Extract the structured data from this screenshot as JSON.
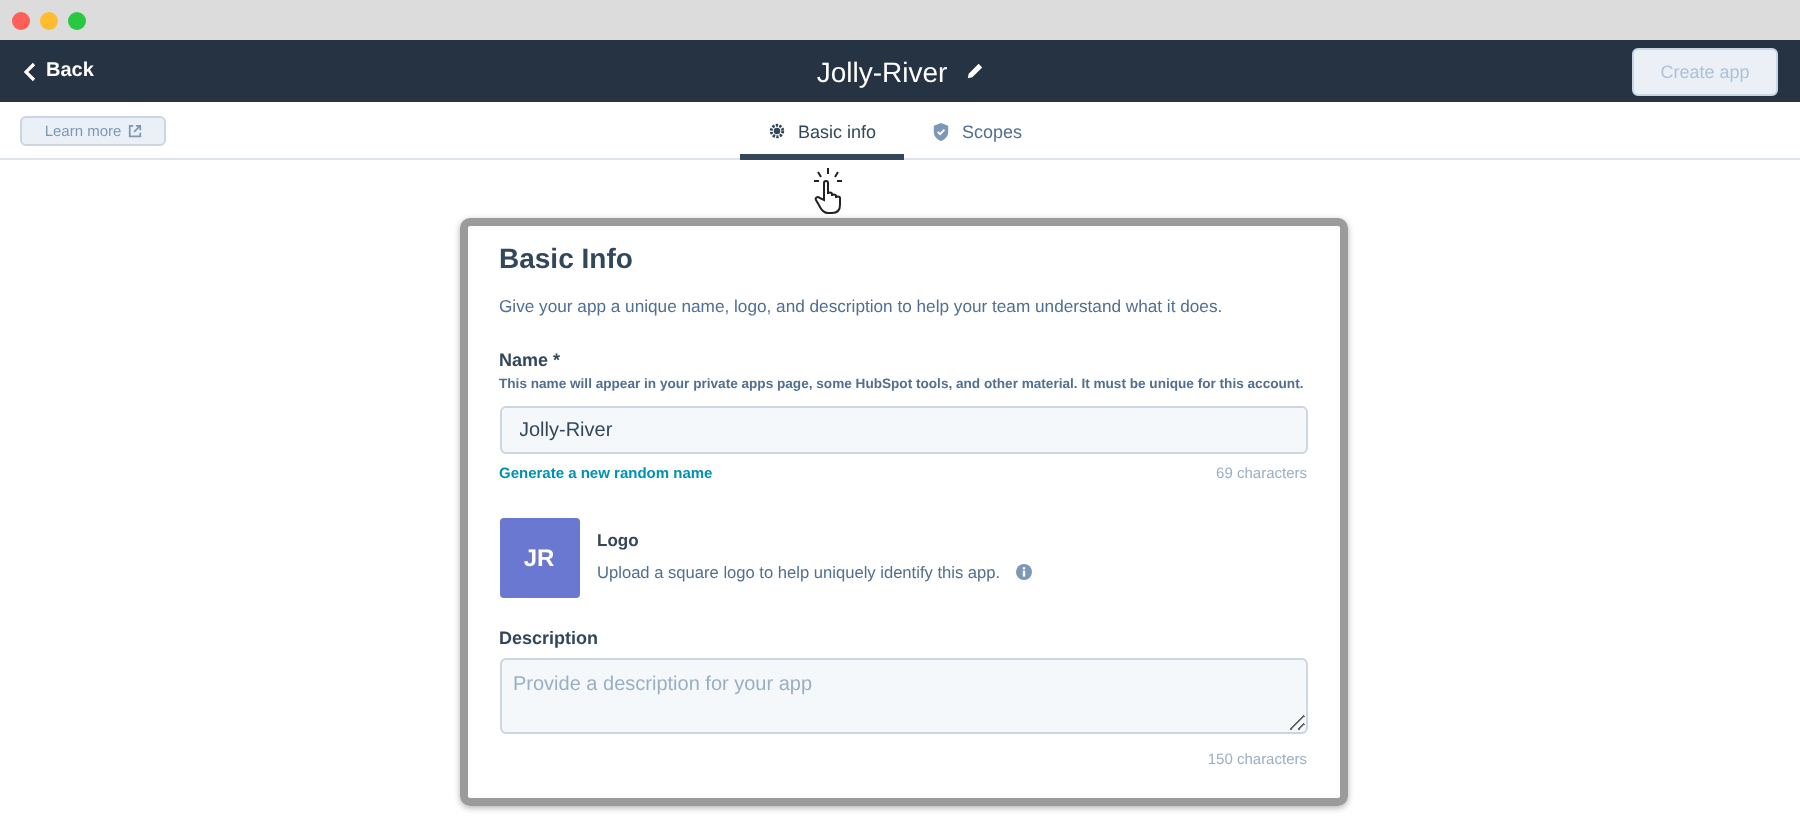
{
  "header": {
    "back": "Back",
    "app_name": "Jolly-River",
    "create_button": {
      "label": "Create app",
      "disabled": true
    }
  },
  "learn_more": "Learn more",
  "tabs": [
    {
      "label": "Basic info",
      "kind": "gear",
      "selected": true
    },
    {
      "label": "Scopes",
      "kind": "shield",
      "selected": false
    }
  ],
  "card": {
    "title": "Basic Info",
    "intro": "Give your app a unique name, logo, and description to help your team understand what it does.",
    "name_field": {
      "label": "Name *",
      "help": "This name will appear in your private apps page, some HubSpot tools, and other material. It must be unique for this account.",
      "value": "Jolly-River",
      "link": "Generate a new random name",
      "counter": "69 characters"
    },
    "logo": {
      "initials": "JR",
      "title": "Logo",
      "description": "Upload a square logo to help uniquely identify this app."
    },
    "description_field": {
      "label": "Description",
      "placeholder": "Provide a description for your app",
      "counter": "150 characters"
    }
  }
}
